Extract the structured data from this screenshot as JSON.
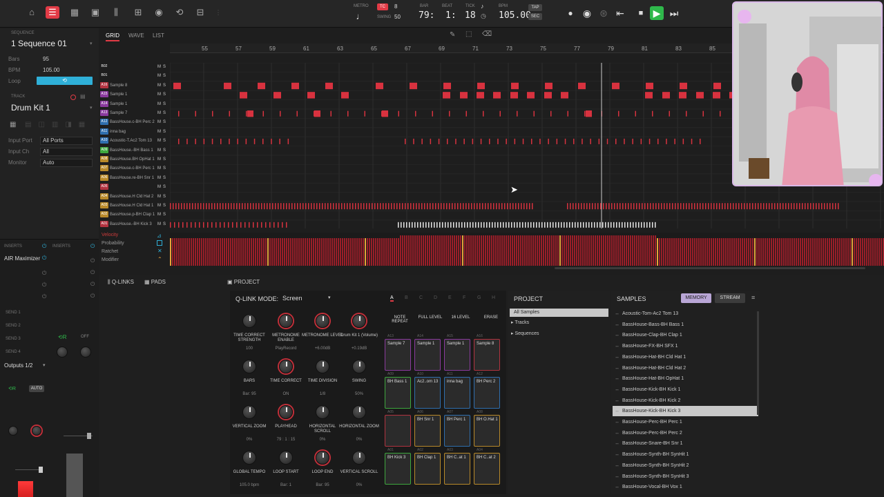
{
  "topbar": {
    "metro_label": "METRO",
    "tc_label": "TC",
    "tc_value": "8",
    "swing_label": "SWING",
    "swing_value": "50",
    "bar_label": "BAR",
    "beat_label": "BEAT",
    "tick_label": "TICK",
    "bar_value": "79:",
    "beat_value": "1:",
    "tick_value": "18",
    "bpm_label": "BPM",
    "bpm_value": "105.00",
    "tap_label": "TAP",
    "sec_label": "SEC"
  },
  "sequence": {
    "section_label": "SEQUENCE",
    "name": "1 Sequence 01",
    "bars_label": "Bars",
    "bars_value": "95",
    "bpm_label": "BPM",
    "bpm_value": "105.00",
    "loop_label": "Loop"
  },
  "track": {
    "section_label": "TRACK",
    "name": "Drum Kit 1",
    "input_port_label": "Input Port",
    "input_port_value": "All Ports",
    "input_ch_label": "Input Ch",
    "input_ch_value": "All",
    "monitor_label": "Monitor",
    "monitor_value": "Auto"
  },
  "inserts": {
    "label_left": "INSERTS",
    "label_right": "INSERTS",
    "plugin": "AIR Maximizer",
    "send1": "SEND 1",
    "send2": "SEND 2",
    "send3": "SEND 3",
    "send4": "SEND 4",
    "off_label": "OFF",
    "outputs": "Outputs 1/2",
    "auto_label": "AUTO",
    "r_label": "R"
  },
  "grid": {
    "tabs": [
      "GRID",
      "WAVE",
      "LIST"
    ],
    "ruler": [
      "55",
      "57",
      "59",
      "61",
      "63",
      "65",
      "67",
      "69",
      "71",
      "73",
      "75",
      "77",
      "79",
      "81",
      "83",
      "85"
    ],
    "tracks": [
      {
        "pad": "B02",
        "name": "",
        "color": "#1e1e1e"
      },
      {
        "pad": "B01",
        "name": "",
        "color": "#1e1e1e"
      },
      {
        "pad": "A16",
        "name": "Sample 8",
        "color": "#b23340"
      },
      {
        "pad": "A15",
        "name": "Sample 1",
        "color": "#8b3a9e"
      },
      {
        "pad": "A14",
        "name": "Sample 1",
        "color": "#8b3a9e"
      },
      {
        "pad": "A13",
        "name": "Sample 7",
        "color": "#8b3a9e"
      },
      {
        "pad": "A12",
        "name": "BassHouse.c-BH Perc 2",
        "color": "#2f6fae"
      },
      {
        "pad": "A11",
        "name": "inna bag",
        "color": "#2f6fae"
      },
      {
        "pad": "A10",
        "name": "Acoustic-T.Ac2 Tom 13",
        "color": "#2f6fae"
      },
      {
        "pad": "A09",
        "name": "BassHouse.-BH Bass 1",
        "color": "#3ea83e"
      },
      {
        "pad": "A08",
        "name": "BassHouse.BH OpHat 1",
        "color": "#b98a2a"
      },
      {
        "pad": "A07",
        "name": "BassHouse.c-BH Perc 1",
        "color": "#b98a2a"
      },
      {
        "pad": "A06",
        "name": "BassHouse.re-BH Snr 1",
        "color": "#b98a2a"
      },
      {
        "pad": "A05",
        "name": "",
        "color": "#b23340"
      },
      {
        "pad": "A04",
        "name": "BassHouse.H Cld Hat 2",
        "color": "#b98a2a"
      },
      {
        "pad": "A03",
        "name": "BassHouse.H Cld Hat 1",
        "color": "#b98a2a"
      },
      {
        "pad": "A02",
        "name": "BassHouse.p-BH Clap 1",
        "color": "#b98a2a"
      },
      {
        "pad": "A01",
        "name": "BassHouse.-BH Kick 3",
        "color": "#b23340"
      }
    ],
    "vel_labels": [
      "Velocity",
      "Probability",
      "Ratchet",
      "Modifier"
    ]
  },
  "bottom": {
    "tabs": [
      "Q-LINKS",
      "PADS"
    ],
    "project_tab": "PROJECT",
    "qlink_mode_label": "Q-LINK MODE:",
    "qlink_mode_value": "Screen",
    "knobs": [
      {
        "title": "TIME CORRECT STRENGTH",
        "value": "100",
        "red": false
      },
      {
        "title": "METRONOME ENABLE",
        "value": "PlayRecord",
        "red": true
      },
      {
        "title": "METRONOME LEVEL",
        "value": "+6.00dB",
        "red": true
      },
      {
        "title": "Drum Kit 1 (Volume)",
        "value": "+0.19dB",
        "red": true
      },
      {
        "title": "BARS",
        "value": "Bar: 95",
        "red": false
      },
      {
        "title": "TIME CORRECT",
        "value": "ON",
        "red": true
      },
      {
        "title": "TIME DIVISION",
        "value": "1/8",
        "red": false
      },
      {
        "title": "SWING",
        "value": "50%",
        "red": false
      },
      {
        "title": "VERTICAL ZOOM",
        "value": "0%",
        "red": false
      },
      {
        "title": "PLAYHEAD",
        "value": "79 : 1 : 15",
        "red": true
      },
      {
        "title": "HORIZONTAL SCROLL",
        "value": "0%",
        "red": false
      },
      {
        "title": "HORIZONTAL ZOOM",
        "value": "0%",
        "red": false
      },
      {
        "title": "GLOBAL TEMPO",
        "value": "105.0 bpm",
        "red": false
      },
      {
        "title": "LOOP START",
        "value": "Bar: 1",
        "red": false
      },
      {
        "title": "LOOP END",
        "value": "Bar: 95",
        "red": true
      },
      {
        "title": "VERTICAL SCROLL",
        "value": "0%",
        "red": false
      }
    ],
    "pad_banks": [
      "A",
      "B",
      "C",
      "D",
      "E",
      "F",
      "G",
      "H"
    ],
    "pad_modes": [
      "NOTE REPEAT",
      "FULL LEVEL",
      "16 LEVEL",
      "ERASE"
    ],
    "pads": [
      {
        "id": "A13",
        "label": "Sample 7",
        "color": "#8b3a9e"
      },
      {
        "id": "A14",
        "label": "Sample 1",
        "color": "#8b3a9e"
      },
      {
        "id": "A15",
        "label": "Sample 1",
        "color": "#8b3a9e"
      },
      {
        "id": "A16",
        "label": "Sample 8",
        "color": "#b23340"
      },
      {
        "id": "A09",
        "label": "BH Bass 1",
        "color": "#3ea83e"
      },
      {
        "id": "A10",
        "label": "Ac2..om 13",
        "color": "#2f6fae"
      },
      {
        "id": "A11",
        "label": "inna bag",
        "color": "#2f6fae"
      },
      {
        "id": "A12",
        "label": "BH Perc 2",
        "color": "#2f6fae"
      },
      {
        "id": "A05",
        "label": "",
        "color": "#b23340"
      },
      {
        "id": "A06",
        "label": "BH Snr 1",
        "color": "#b98a2a"
      },
      {
        "id": "A07",
        "label": "BH Perc 1",
        "color": "#2f6fae"
      },
      {
        "id": "A08",
        "label": "BH O.Hat 1",
        "color": "#b98a2a"
      },
      {
        "id": "A01",
        "label": "BH Kick 3",
        "color": "#3ea83e"
      },
      {
        "id": "A02",
        "label": "BH Clap 1",
        "color": "#b98a2a"
      },
      {
        "id": "A03",
        "label": "BH C..at 1",
        "color": "#b98a2a"
      },
      {
        "id": "A04",
        "label": "BH C..at 2",
        "color": "#b98a2a"
      }
    ],
    "project": {
      "title": "PROJECT",
      "items": [
        "All Samples",
        "Tracks",
        "Sequences"
      ]
    },
    "samples": {
      "title": "SAMPLES",
      "memory": "MEMORY",
      "stream": "STREAM",
      "items": [
        "Acoustic-Tom-Ac2 Tom 13",
        "BassHouse-Bass-BH Bass 1",
        "BassHouse-Clap-BH Clap 1",
        "BassHouse-FX-BH SFX 1",
        "BassHouse-Hat-BH Cld Hat 1",
        "BassHouse-Hat-BH Cld Hat 2",
        "BassHouse-Hat-BH OpHat 1",
        "BassHouse-Kick-BH Kick 1",
        "BassHouse-Kick-BH Kick 2",
        "BassHouse-Kick-BH Kick 3",
        "BassHouse-Perc-BH Perc 1",
        "BassHouse-Perc-BH Perc 2",
        "BassHouse-Snare-BH Snr 1",
        "BassHouse-Synth-BH SynHit 1",
        "BassHouse-Synth-BH SynHit 2",
        "BassHouse-Synth-BH SynHit 3",
        "BassHouse-Vocal-BH Vox 1"
      ],
      "selected_index": 9
    }
  },
  "colors": {
    "accent_red": "#e23b46",
    "note_red": "#d8323f",
    "play_green": "#2fb84b",
    "loop_blue": "#2fb0d8"
  }
}
